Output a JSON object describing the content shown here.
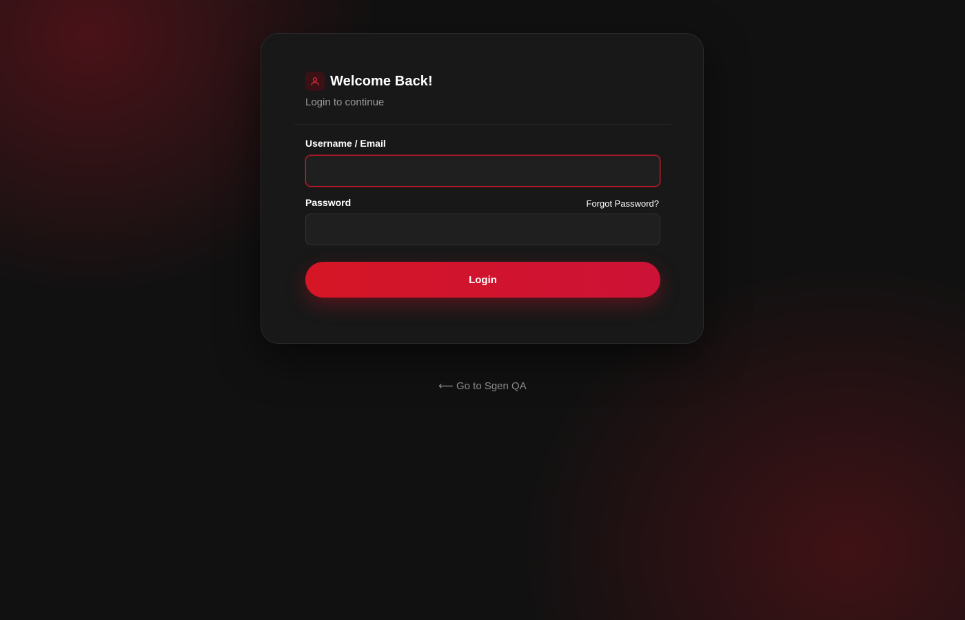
{
  "header": {
    "title": "Welcome Back!",
    "subtitle": "Login to continue",
    "icon": "user-icon"
  },
  "form": {
    "username": {
      "label": "Username / Email",
      "value": "",
      "placeholder": ""
    },
    "password": {
      "label": "Password",
      "value": "",
      "placeholder": ""
    },
    "forgot_label": "Forgot Password?",
    "submit_label": "Login"
  },
  "footer": {
    "back_arrow": "⟵",
    "back_label": "Go to Sgen QA"
  },
  "colors": {
    "accent": "#d51626",
    "background": "#111111",
    "card": "#181818"
  }
}
